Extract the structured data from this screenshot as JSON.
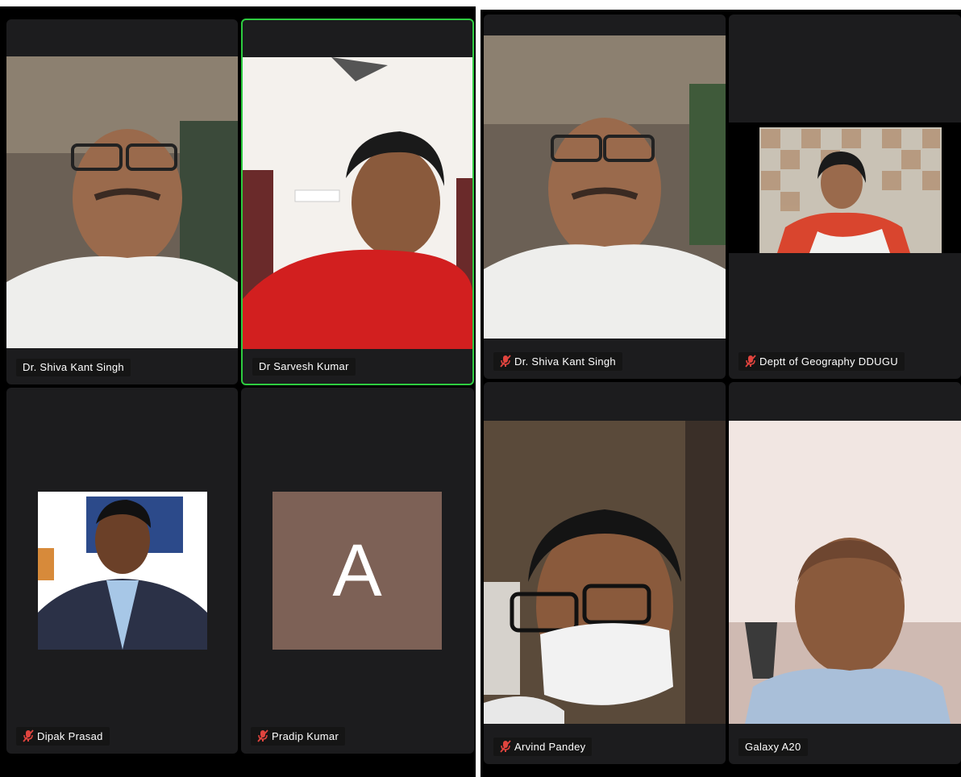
{
  "left_screen": {
    "participants": [
      {
        "name": "Dr. Shiva Kant Singh",
        "muted": false,
        "active_speaker": false
      },
      {
        "name": "Dr Sarvesh Kumar",
        "muted": false,
        "active_speaker": true
      },
      {
        "name": "Dipak Prasad",
        "muted": true,
        "active_speaker": false
      },
      {
        "name": "Pradip Kumar",
        "muted": true,
        "active_speaker": false,
        "avatar_letter": "A"
      }
    ]
  },
  "right_screen": {
    "participants": [
      {
        "name": "Dr. Shiva Kant Singh",
        "muted": true
      },
      {
        "name": "Deptt of Geography DDUGU",
        "muted": true
      },
      {
        "name": "Arvind Pandey",
        "muted": true
      },
      {
        "name": "Galaxy A20",
        "muted": false
      }
    ]
  },
  "colors": {
    "tile_bg": "#1c1c1e",
    "active_border": "#2ecc40",
    "muted_icon": "#e0443e",
    "avatar_bg": "#7d6156"
  }
}
